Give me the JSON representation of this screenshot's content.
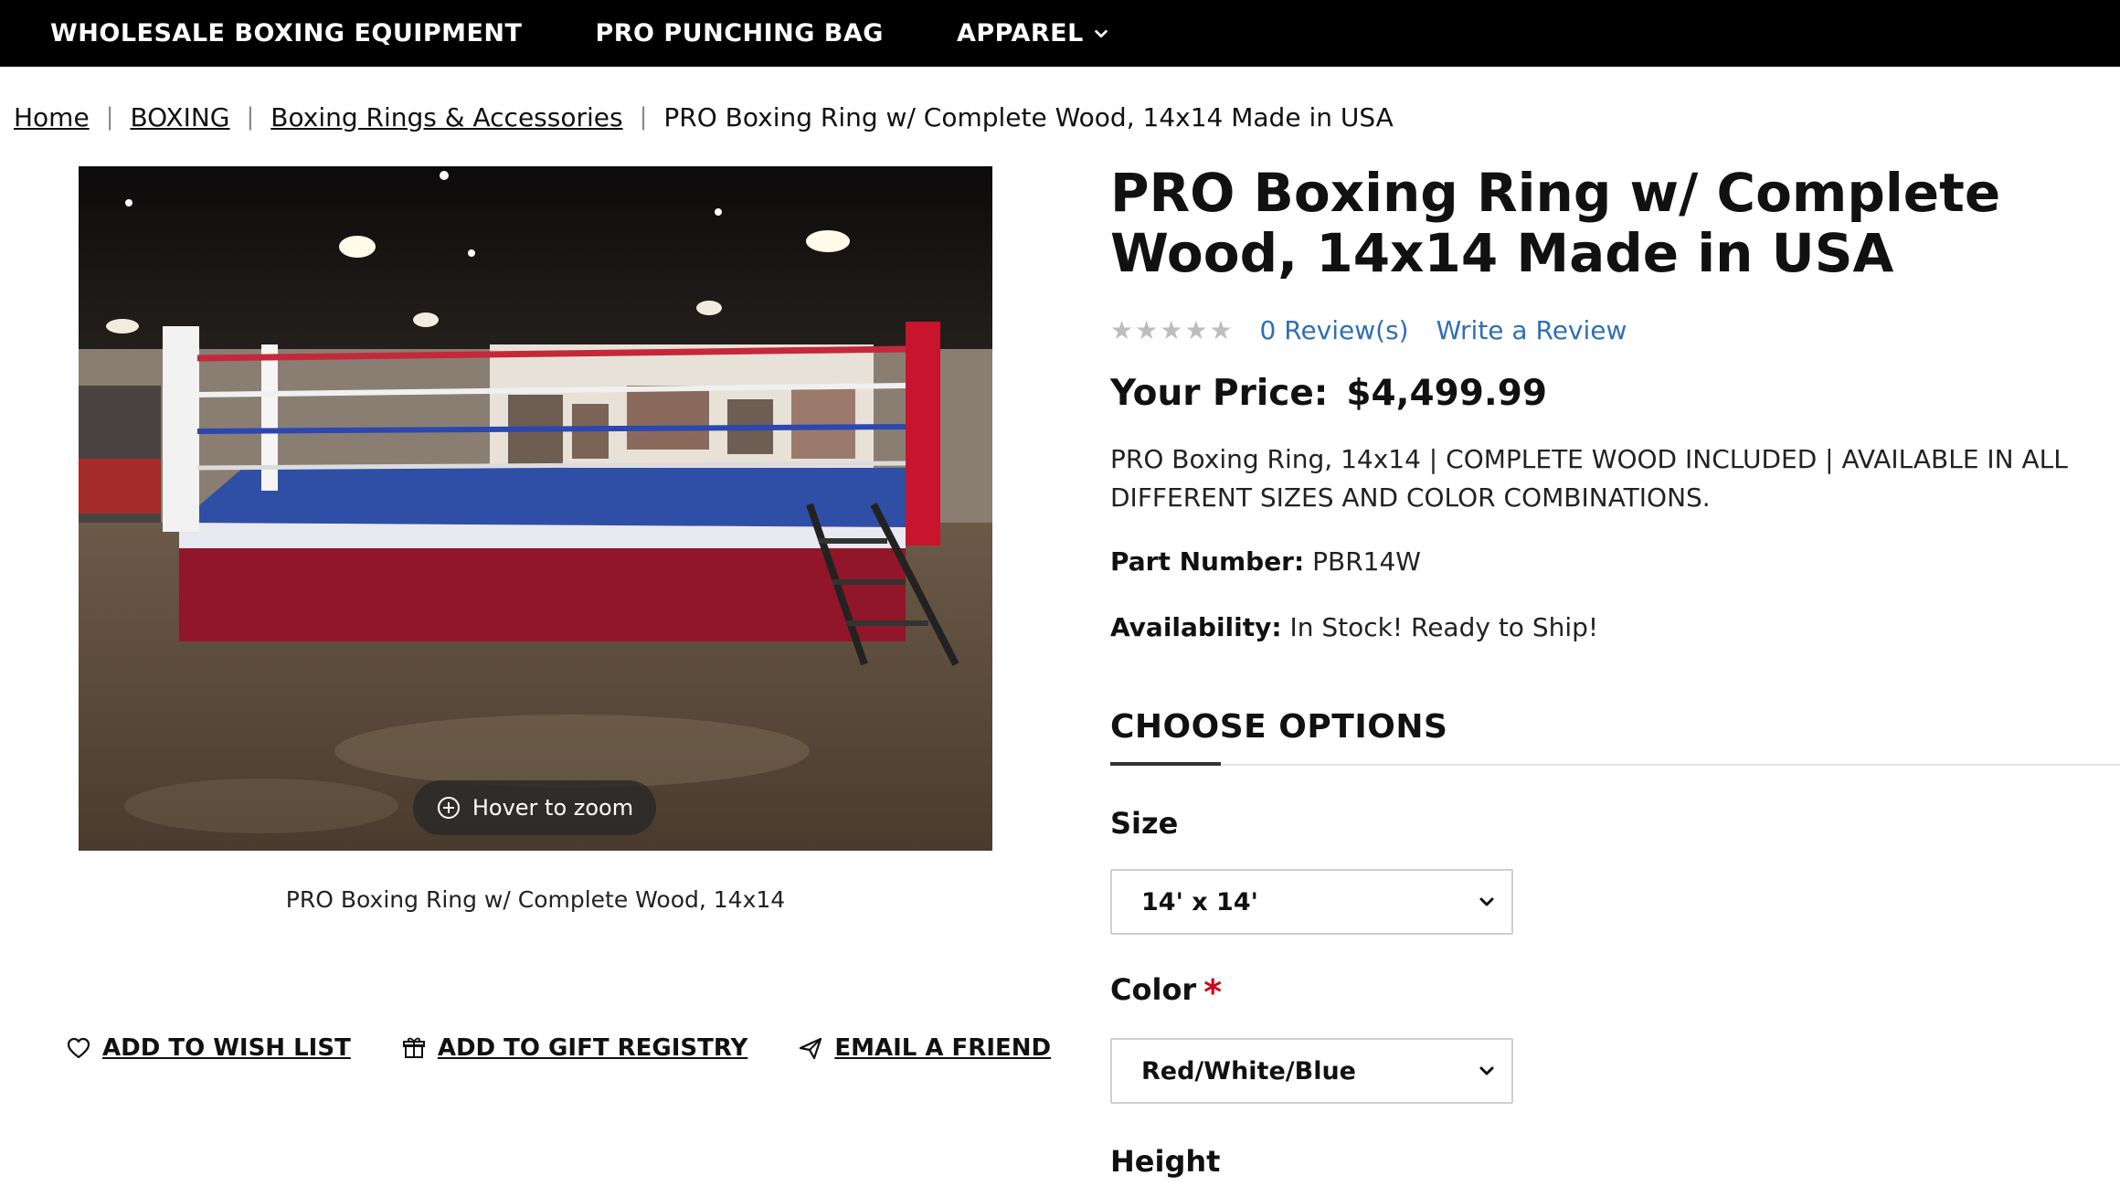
{
  "nav": {
    "items": [
      "WHOLESALE BOXING EQUIPMENT",
      "PRO PUNCHING BAG",
      "APPAREL"
    ]
  },
  "breadcrumb": [
    "Home",
    "BOXING",
    "Boxing Rings & Accessories",
    "PRO Boxing Ring w/ Complete Wood, 14x14 Made in USA"
  ],
  "gallery": {
    "zoom_hint": "Hover to zoom",
    "caption": "PRO Boxing Ring w/ Complete Wood, 14x14"
  },
  "actions": {
    "wish_list": "ADD TO WISH LIST",
    "gift_registry": "ADD TO GIFT REGISTRY",
    "email_friend": "EMAIL A FRIEND"
  },
  "product": {
    "title": "PRO Boxing Ring w/ Complete Wood, 14x14 Made in USA",
    "rating_stars": 0,
    "reviews_link": "0 Review(s)",
    "write_review": "Write a Review",
    "price_label": "Your Price:",
    "price_value": "$4,499.99",
    "description": "PRO Boxing Ring, 14x14 | COMPLETE WOOD INCLUDED | AVAILABLE IN ALL DIFFERENT SIZES AND COLOR COMBINATIONS.",
    "part_number_label": "Part Number:",
    "part_number": "PBR14W",
    "availability_label": "Availability:",
    "availability": "In Stock! Ready to Ship!"
  },
  "options": {
    "heading": "CHOOSE OPTIONS",
    "size_label": "Size",
    "size_value": "14' x 14'",
    "color_label": "Color",
    "color_required": "*",
    "color_value": "Red/White/Blue",
    "height_label": "Height"
  },
  "colors": {
    "nav_bg": "#000000",
    "link": "#2f6fb5",
    "required": "#d0021b",
    "star_empty": "#bdbdbd"
  }
}
